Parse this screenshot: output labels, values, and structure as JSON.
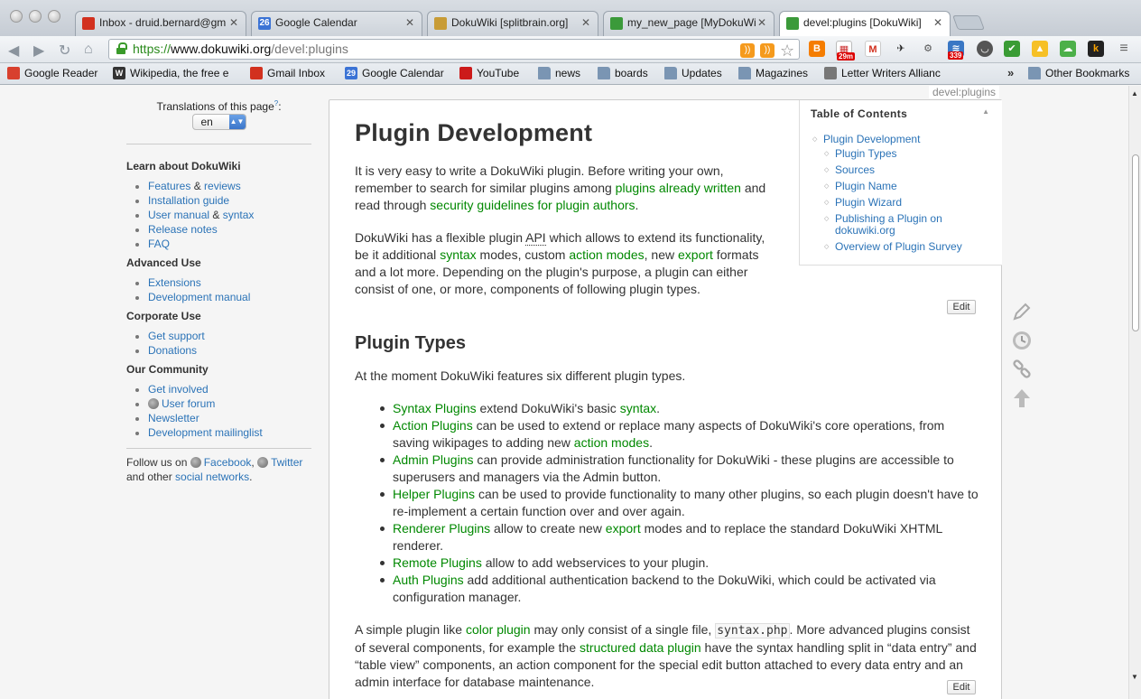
{
  "browser": {
    "tabs": [
      {
        "title": "Inbox - druid.bernard@gm",
        "icon": "gmail-icon",
        "color": "#d2311f"
      },
      {
        "title": "Google Calendar",
        "icon": "calendar-icon",
        "color": "#3b73d5",
        "icon_text": "26"
      },
      {
        "title": "DokuWiki [splitbrain.org]",
        "icon": "dokuwiki-icon",
        "color": "#c89c36"
      },
      {
        "title": "my_new_page [MyDokuWi",
        "icon": "dokuwiki-icon",
        "color": "#3b9a3a"
      },
      {
        "title": "devel:plugins [DokuWiki]",
        "icon": "dokuwiki-icon",
        "color": "#3b9a3a"
      }
    ],
    "url": {
      "scheme": "https://",
      "host": "www.dokuwiki.org",
      "path": "/devel:plugins"
    },
    "bookmarks": [
      {
        "label": "Google Reader",
        "icon": "reader-icon",
        "color": "#d8402e"
      },
      {
        "label": "Wikipedia, the free e",
        "icon": "wikipedia-icon",
        "color": "#333333",
        "icon_text": "W"
      },
      {
        "label": "Gmail Inbox",
        "icon": "gmail-icon",
        "color": "#d2311f"
      },
      {
        "label": "Google Calendar",
        "icon": "calendar-icon",
        "color": "#3b73d5",
        "icon_text": "29"
      },
      {
        "label": "YouTube",
        "icon": "youtube-icon",
        "color": "#cc1a1a"
      },
      {
        "label": "news",
        "icon": "folder-icon"
      },
      {
        "label": "boards",
        "icon": "folder-icon"
      },
      {
        "label": "Updates",
        "icon": "folder-icon"
      },
      {
        "label": "Magazines",
        "icon": "folder-icon"
      },
      {
        "label": "Letter Writers Allianc",
        "icon": "lwa-icon",
        "color": "#777777"
      },
      {
        "label": "Other Bookmarks",
        "icon": "folder-icon"
      }
    ],
    "more_bookmarks": "»",
    "extension_badges": {
      "calendar": "29m",
      "feed": "339"
    }
  },
  "page": {
    "breadcrumb": "devel:plugins",
    "translations_label": "Translations of this page",
    "translations_help": "?",
    "translations_colon": ":",
    "language": "en",
    "sidebar": {
      "sections": [
        {
          "title": "Learn about DokuWiki",
          "items": [
            [
              {
                "t": "Features",
                "link": true
              },
              {
                "t": " & ",
                "link": false
              },
              {
                "t": "reviews",
                "link": true
              }
            ],
            [
              {
                "t": "Installation guide",
                "link": true
              }
            ],
            [
              {
                "t": "User manual",
                "link": true
              },
              {
                "t": " & ",
                "link": false
              },
              {
                "t": "syntax",
                "link": true
              }
            ],
            [
              {
                "t": "Release notes",
                "link": true
              }
            ],
            [
              {
                "t": "FAQ",
                "link": true
              }
            ]
          ]
        },
        {
          "title": "Advanced Use",
          "items": [
            [
              {
                "t": "Extensions",
                "link": true
              }
            ],
            [
              {
                "t": "Development manual",
                "link": true
              }
            ]
          ]
        },
        {
          "title": "Corporate Use",
          "items": [
            [
              {
                "t": "Get support",
                "link": true
              }
            ],
            [
              {
                "t": "Donations",
                "link": true
              }
            ]
          ]
        },
        {
          "title": "Our Community",
          "items": [
            [
              {
                "t": "Get involved",
                "link": true
              }
            ],
            [
              {
                "t": "User forum",
                "link": true,
                "globe": true
              }
            ],
            [
              {
                "t": "Newsletter",
                "link": true
              }
            ],
            [
              {
                "t": "Development mailinglist",
                "link": true
              }
            ]
          ]
        }
      ],
      "follow": {
        "prefix": "Follow us on ",
        "facebook": "Facebook",
        "comma": ",",
        "twitter": "Twitter",
        "and_other": "and other ",
        "social": "social networks",
        "period": "."
      }
    },
    "toc": {
      "heading": "Table of Contents",
      "toggle": "▲",
      "top": "Plugin Development",
      "items": [
        "Plugin Types",
        "Sources",
        "Plugin Name",
        "Plugin Wizard",
        "Publishing a Plugin on dokuwiki.org",
        "Overview of Plugin Survey"
      ]
    },
    "h1": "Plugin Development",
    "p1": [
      {
        "t": "It is very easy to write a DokuWiki plugin. Before writing your own, remember to search for similar plugins among "
      },
      {
        "t": "plugins already written",
        "link": true
      },
      {
        "t": " and read through "
      },
      {
        "t": "security guidelines for plugin authors",
        "link": true
      },
      {
        "t": "."
      }
    ],
    "p2": [
      {
        "t": "DokuWiki has a flexible plugin "
      },
      {
        "t": "API",
        "abbr": true
      },
      {
        "t": " which allows to extend its functionality, be it additional "
      },
      {
        "t": "syntax",
        "link": true
      },
      {
        "t": " modes, custom "
      },
      {
        "t": "action modes",
        "link": true
      },
      {
        "t": ", new "
      },
      {
        "t": "export",
        "link": true
      },
      {
        "t": " formats and a lot more. Depending on the plugin's purpose, a plugin can either consist of one, or more, components of following plugin types."
      }
    ],
    "edit_label": "Edit",
    "h2": "Plugin Types",
    "p3": "At the moment DokuWiki features six different plugin types.",
    "plugin_types": [
      [
        {
          "t": "Syntax Plugins",
          "link": true
        },
        {
          "t": " extend DokuWiki's basic "
        },
        {
          "t": "syntax",
          "link": true
        },
        {
          "t": "."
        }
      ],
      [
        {
          "t": "Action Plugins",
          "link": true
        },
        {
          "t": " can be used to extend or replace many aspects of DokuWiki's core operations, from saving wikipages to adding new "
        },
        {
          "t": "action modes",
          "link": true
        },
        {
          "t": "."
        }
      ],
      [
        {
          "t": "Admin Plugins",
          "link": true
        },
        {
          "t": " can provide administration functionality for DokuWiki - these plugins are accessible to superusers and managers via the Admin button."
        }
      ],
      [
        {
          "t": "Helper Plugins",
          "link": true
        },
        {
          "t": " can be used to provide functionality to many other plugins, so each plugin doesn't have to re-implement a certain function over and over again."
        }
      ],
      [
        {
          "t": "Renderer Plugins",
          "link": true
        },
        {
          "t": " allow to create new "
        },
        {
          "t": "export",
          "link": true
        },
        {
          "t": " modes and to replace the standard DokuWiki XHTML renderer."
        }
      ],
      [
        {
          "t": "Remote Plugins",
          "link": true
        },
        {
          "t": " allow to add webservices to your plugin."
        }
      ],
      [
        {
          "t": "Auth Plugins",
          "link": true
        },
        {
          "t": " add additional authentication backend to the DokuWiki, which could be activated via configuration manager."
        }
      ]
    ],
    "p4": [
      {
        "t": "A simple plugin like "
      },
      {
        "t": "color plugin",
        "link": true
      },
      {
        "t": " may only consist of a single file, "
      },
      {
        "t": "syntax.php",
        "code": true
      },
      {
        "t": ". More advanced plugins consist of several components, for example the "
      },
      {
        "t": "structured data plugin",
        "link": true
      },
      {
        "t": " have the syntax handling split in “data entry” and “table view” components, an action component for the special edit button attached to every data entry and an admin interface for database maintenance."
      }
    ],
    "page_tools": [
      "edit-icon",
      "revisions-icon",
      "backlinks-icon",
      "back-to-top-icon"
    ]
  }
}
